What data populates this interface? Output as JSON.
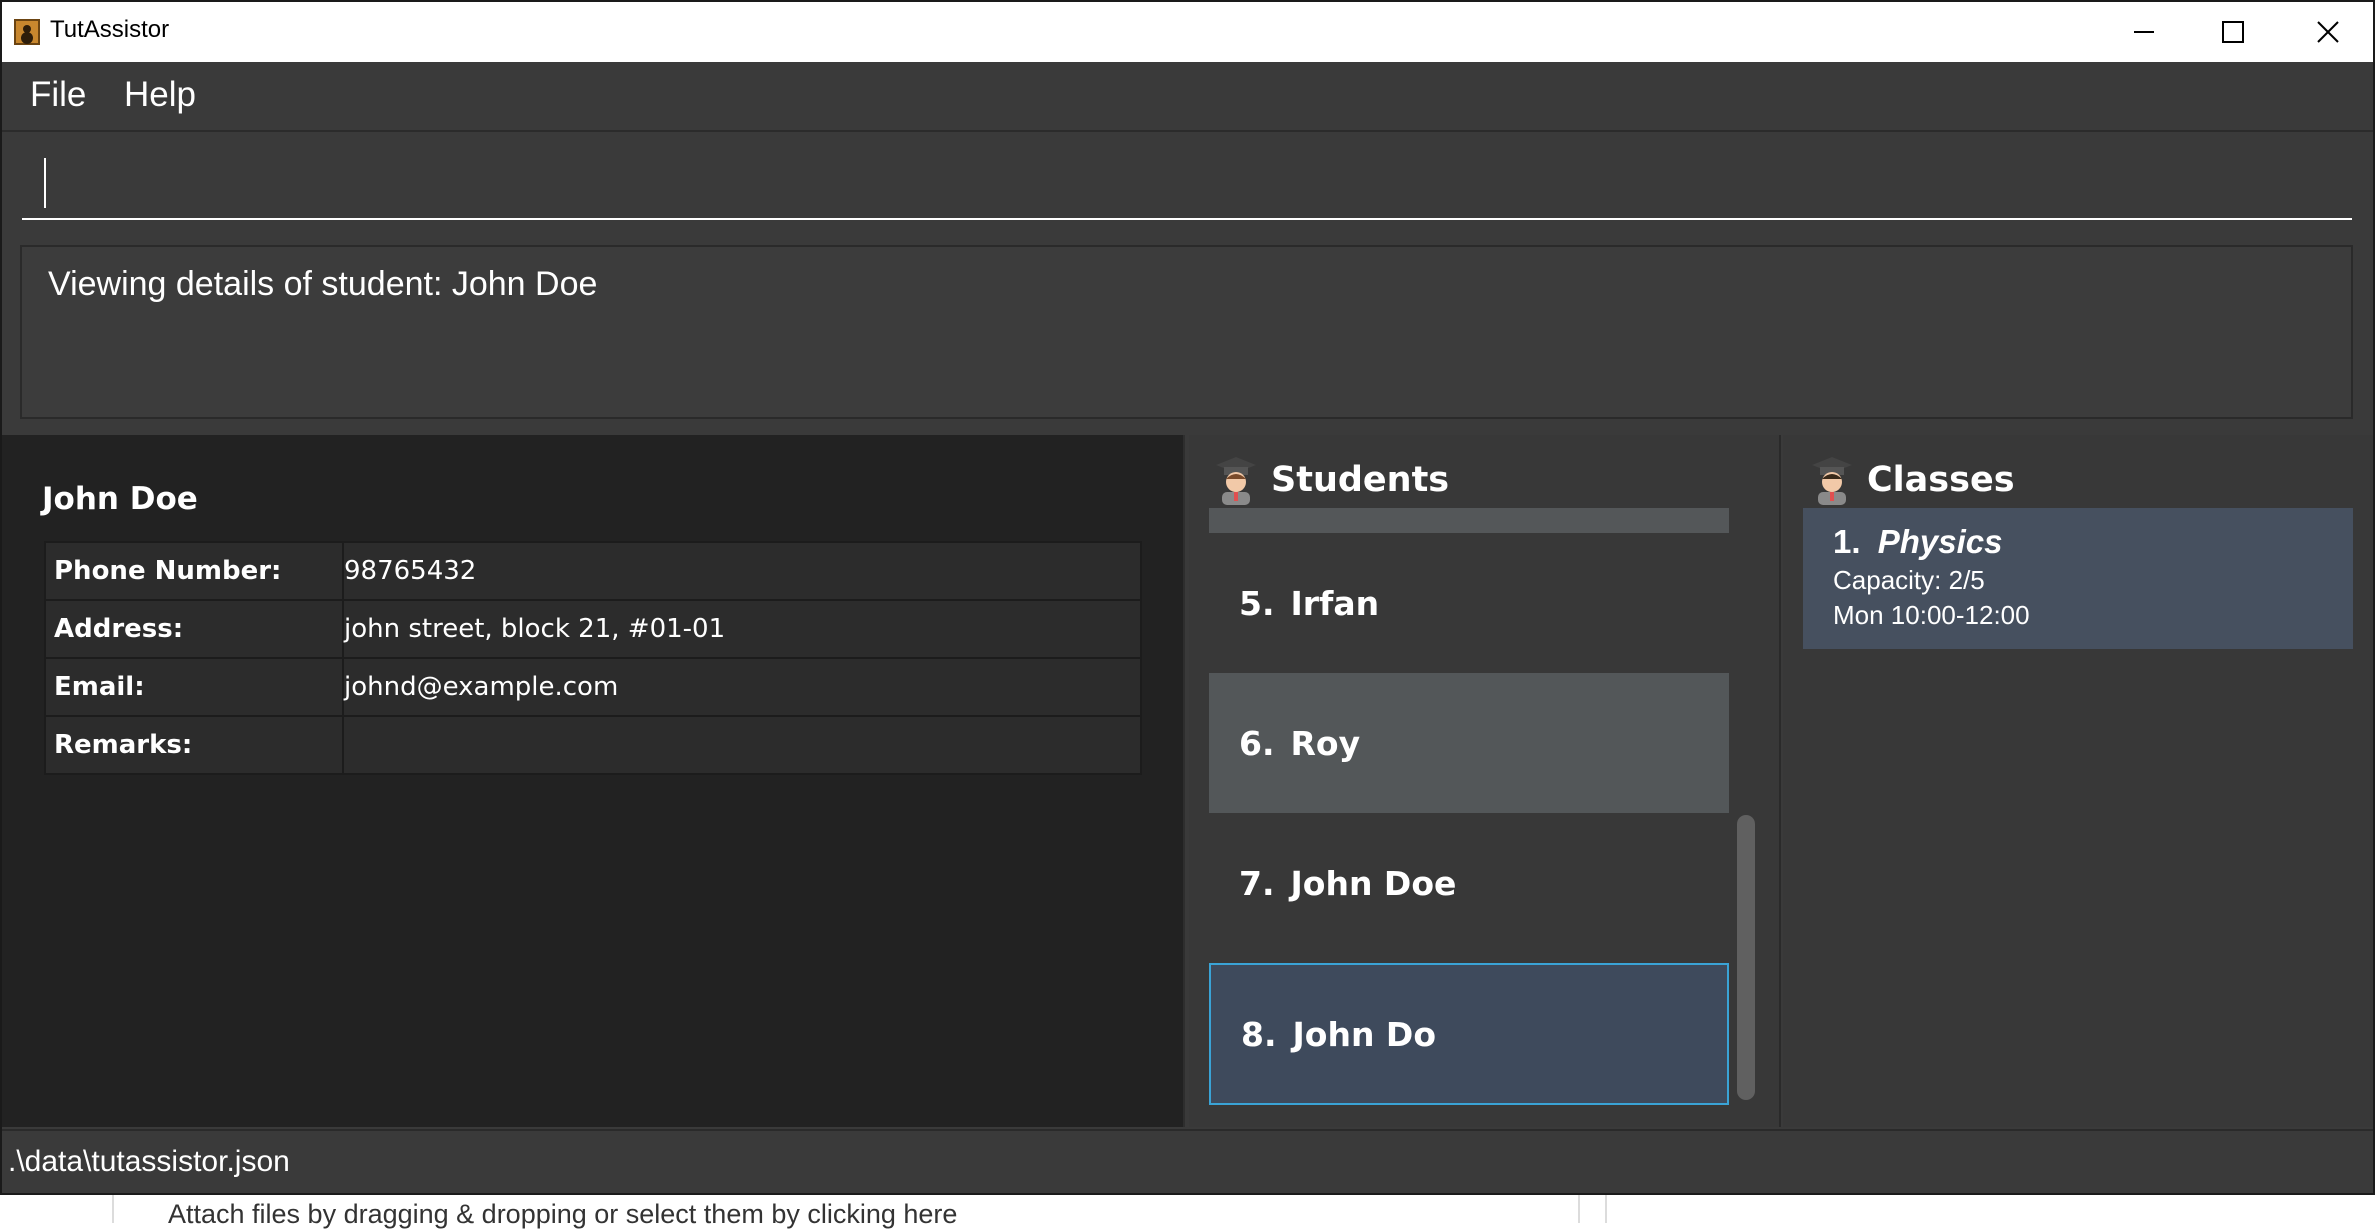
{
  "window": {
    "title": "TutAssistor"
  },
  "menu": {
    "file": "File",
    "help": "Help"
  },
  "command": {
    "value": ""
  },
  "result": {
    "message": "Viewing details of student: John Doe"
  },
  "detail": {
    "name": "John Doe",
    "rows": [
      {
        "label": "Phone Number:",
        "value": "98765432"
      },
      {
        "label": "Address:",
        "value": "john street, block 21, #01-01"
      },
      {
        "label": "Email:",
        "value": "johnd@example.com"
      },
      {
        "label": "Remarks:",
        "value": ""
      }
    ]
  },
  "students": {
    "title": "Students",
    "items": [
      {
        "index": "5.",
        "name": "Irfan"
      },
      {
        "index": "6.",
        "name": "Roy"
      },
      {
        "index": "7.",
        "name": "John Doe"
      },
      {
        "index": "8.",
        "name": "John Do"
      }
    ]
  },
  "classes": {
    "title": "Classes",
    "items": [
      {
        "index": "1.",
        "name": "Physics",
        "capacity": "Capacity: 2/5",
        "time": "Mon 10:00-12:00"
      }
    ]
  },
  "status": {
    "path": ".\\data\\tutassistor.json"
  },
  "background": {
    "attach_text": "Attach files by dragging & dropping or select them by clicking here"
  },
  "colors": {
    "window_bg": "#3a3a3a",
    "detail_bg": "#222222",
    "selected_item": "#3e4a5c",
    "selected_border": "#3aa3d6",
    "class_card": "#46505f"
  }
}
